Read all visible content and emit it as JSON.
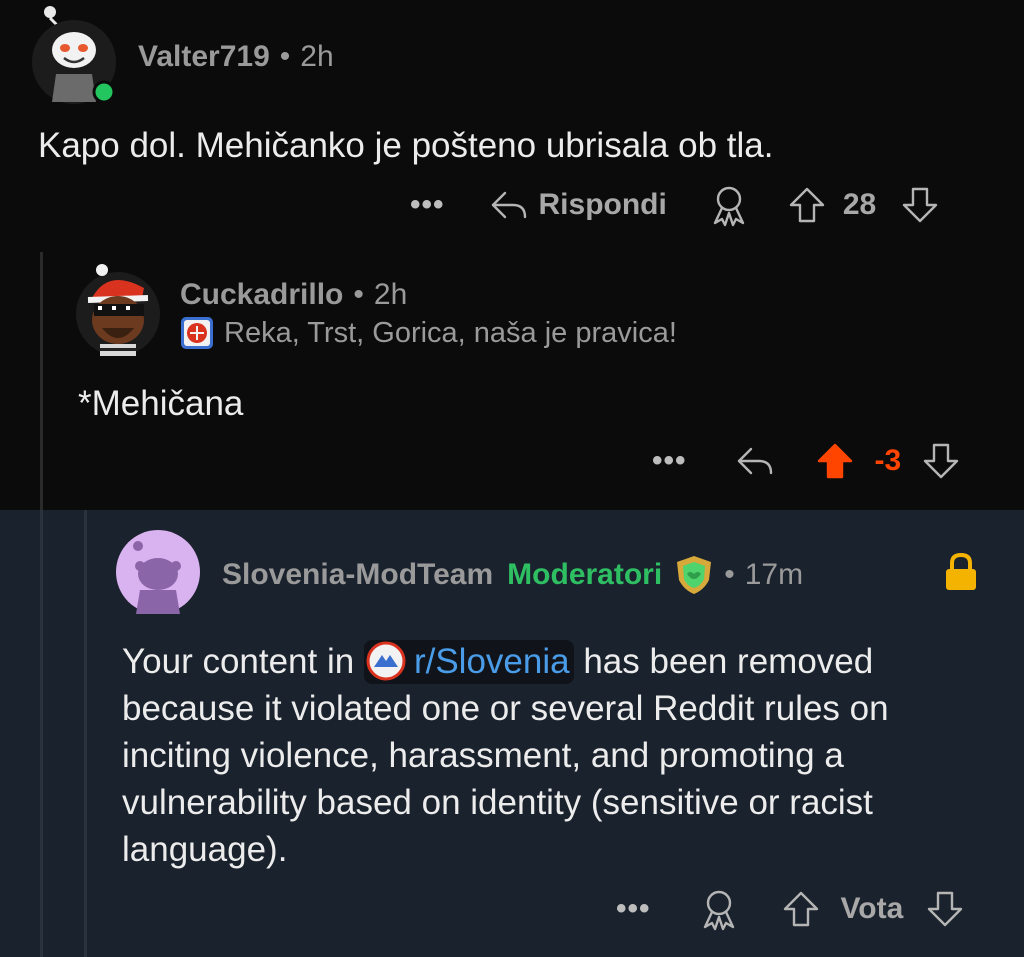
{
  "comment1": {
    "username": "Valter719",
    "time": "2h",
    "text": "Kapo dol. Mehičanko je pošteno ubrisala ob tla.",
    "actions": {
      "more": "•••",
      "reply": "Rispondi",
      "score": "28"
    }
  },
  "comment2": {
    "username": "Cuckadrillo",
    "time": "2h",
    "flair": "Reka, Trst, Gorica, naša je pravica!",
    "text": "*Mehičana",
    "actions": {
      "more": "•••",
      "score": "-3"
    }
  },
  "comment3": {
    "username": "Slovenia-ModTeam",
    "role": "Moderatori",
    "time": "17m",
    "text_before": "Your content in ",
    "subreddit": "r/Slovenia",
    "text_after": " has been removed because it violated one or several Reddit rules on inciting violence, harassment, and promoting a vulnerability based on identity (sensitive or racist language).",
    "actions": {
      "more": "•••",
      "vote": "Vota"
    }
  },
  "colors": {
    "background": "#0b0b0b",
    "mod_panel": "#1a222d",
    "moderator_green": "#2fbf63",
    "upvote_orange": "#ff4500",
    "link_blue": "#4a9ce8",
    "online_green": "#22c55e",
    "lock_gold": "#f5b301"
  }
}
